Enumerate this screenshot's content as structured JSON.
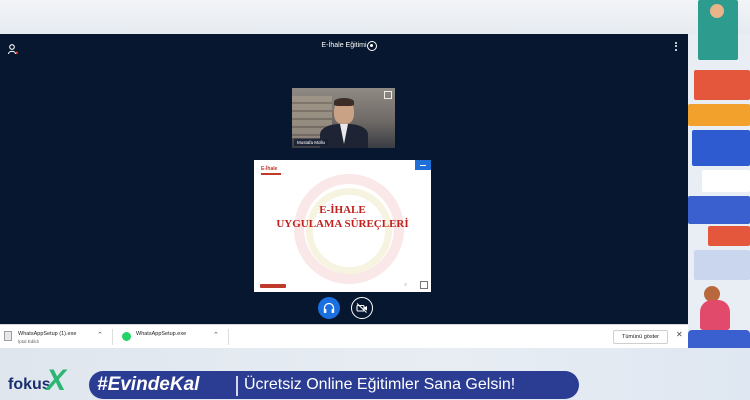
{
  "meeting": {
    "title": "E-İhale Eğitimi",
    "participant_name": "Mustafa Mollu"
  },
  "slide": {
    "logo_text": "E-İhale",
    "title_line1": "E-İHALE",
    "title_line2": "UYGULAMA SÜREÇLERİ"
  },
  "downloads": {
    "items": [
      {
        "name": "WhatsAppSetup (1).exe",
        "status": "İptal Edildi",
        "icon": "file-icon"
      },
      {
        "name": "WhatsAppSetup.exe",
        "status": "",
        "icon": "whatsapp-icon"
      }
    ],
    "show_all_label": "Tümünü göster",
    "close_label": "✕"
  },
  "banner": {
    "logo_text": "fokus",
    "logo_x": "X",
    "hashtag": "#EvindeKal",
    "tagline": "Ücretsiz Online Eğitimler Sana Gelsin!"
  },
  "colors": {
    "meeting_bg": "#06172f",
    "accent_blue": "#1b6fe0",
    "slide_red": "#c0211f",
    "banner_pill": "#2b3c93",
    "logo_green": "#2bb673"
  }
}
